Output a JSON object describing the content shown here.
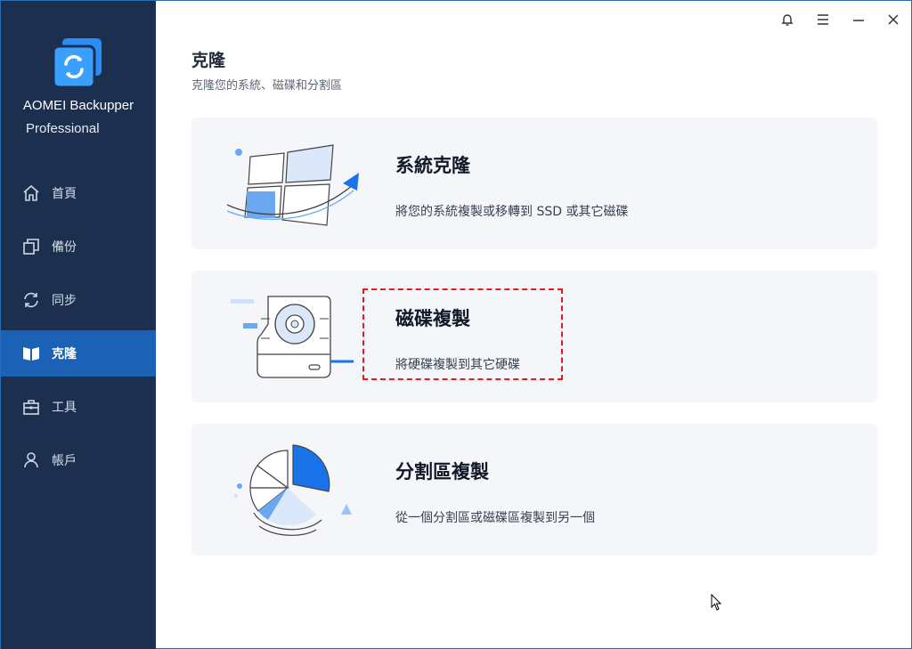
{
  "app": {
    "name": "AOMEI Backupper",
    "edition": "Professional"
  },
  "sidebar": {
    "items": [
      {
        "label": "首頁",
        "icon": "home-icon"
      },
      {
        "label": "備份",
        "icon": "backup-icon"
      },
      {
        "label": "同步",
        "icon": "sync-icon"
      },
      {
        "label": "克隆",
        "icon": "clone-icon",
        "active": true
      },
      {
        "label": "工具",
        "icon": "toolbox-icon"
      },
      {
        "label": "帳戶",
        "icon": "user-icon"
      }
    ]
  },
  "titlebar": {
    "icons": [
      "bell-icon",
      "menu-icon",
      "minimize-icon",
      "close-icon"
    ]
  },
  "header": {
    "title": "克隆",
    "subtitle": "克隆您的系統、磁碟和分割區"
  },
  "cards": [
    {
      "title": "系統克隆",
      "desc": "將您的系統複製或移轉到 SSD 或其它磁碟",
      "icon": "windows-migrate-illustration"
    },
    {
      "title": "磁碟複製",
      "desc": "將硬碟複製到其它硬碟",
      "icon": "disk-illustration"
    },
    {
      "title": "分割區複製",
      "desc": "從一個分割區或磁碟區複製到另一個",
      "icon": "pie-partition-illustration"
    }
  ],
  "colors": {
    "sidebar_bg": "#1d2f4f",
    "active_bg": "#1b62b6",
    "accent": "#1a73e8",
    "highlight": "#e41b1b",
    "card_bg": "#f4f6f9"
  }
}
